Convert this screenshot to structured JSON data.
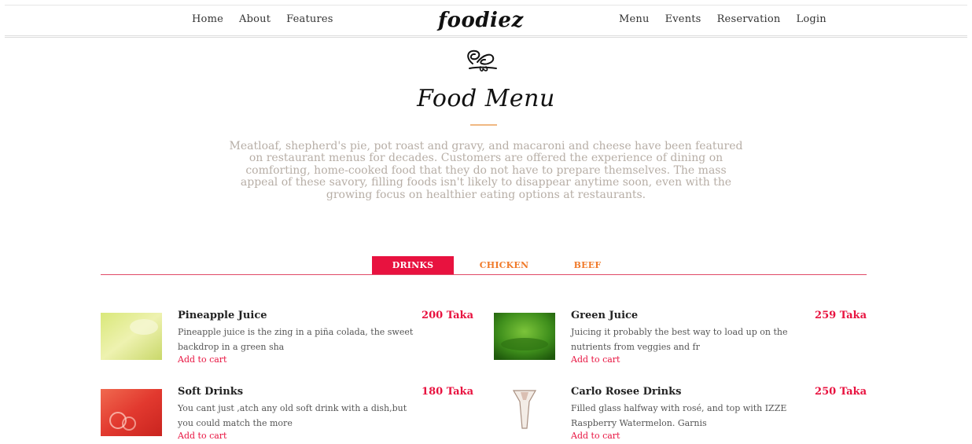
{
  "nav": {
    "left": [
      {
        "label": "Home"
      },
      {
        "label": "About"
      },
      {
        "label": "Features"
      }
    ],
    "brand": "foodiez",
    "right": [
      {
        "label": "Menu"
      },
      {
        "label": "Events"
      },
      {
        "label": "Reservation"
      },
      {
        "label": "Login"
      }
    ]
  },
  "hero": {
    "title": "Food Menu",
    "intro": "Meatloaf, shepherd's pie, pot roast and gravy, and macaroni and cheese have been featured on restaurant menus for decades. Customers are offered the experience of dining on comforting, home-cooked food that they do not have to prepare themselves. The mass appeal of these savory, filling foods isn't likely to disappear anytime soon, even with the growing focus on healthier eating options at restaurants."
  },
  "tabs": [
    {
      "label": "DRINKS",
      "active": true
    },
    {
      "label": "CHICKEN",
      "active": false
    },
    {
      "label": "BEEF",
      "active": false
    }
  ],
  "items": [
    {
      "name": "Pineapple Juice",
      "price": "200 Taka",
      "description": "Pineapple juice is the zing in a piña colada, the sweet backdrop in a green sha",
      "cta": "Add to cart"
    },
    {
      "name": "Green Juice",
      "price": "259 Taka",
      "description": "Juicing it probably the best way to load up on the nutrients from veggies and fr",
      "cta": "Add to cart"
    },
    {
      "name": "Soft Drinks",
      "price": "180 Taka",
      "description": "You cant just ,atch any old soft drink with a dish,but you could match the more",
      "cta": "Add to cart"
    },
    {
      "name": "Carlo Rosee Drinks",
      "price": "250 Taka",
      "description": "Filled glass halfway with rosé, and top with IZZE Raspberry Watermelon. Garnis",
      "cta": "Add to cart"
    }
  ],
  "colors": {
    "accent": "#e8123f",
    "tab_inactive": "#f07a2a",
    "intro_text": "#b7aea6",
    "title_rule": "#f0b882"
  }
}
